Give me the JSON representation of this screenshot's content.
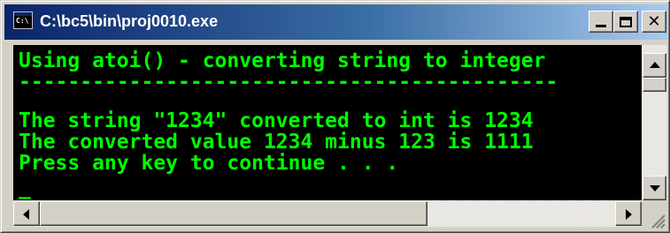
{
  "window": {
    "title": "C:\\bc5\\bin\\proj0010.exe",
    "icon": "console-icon",
    "icon_text": "C:\\"
  },
  "title_buttons": {
    "minimize_icon": "minimize-icon",
    "maximize_icon": "maximize-icon",
    "close_glyph": "✕"
  },
  "console": {
    "text_color": "#00ff00",
    "background": "#000000",
    "lines": [
      "Using atoi() - converting string to integer",
      "--------------------------------------------",
      "",
      "The string \"1234\" converted to int is 1234",
      "The converted value 1234 minus 123 is 1111",
      "Press any key to continue . . ."
    ],
    "cursor": "_"
  },
  "colors": {
    "titlebar_start": "#0a246a",
    "titlebar_end": "#a6caf0",
    "chrome": "#d4d0c8"
  }
}
